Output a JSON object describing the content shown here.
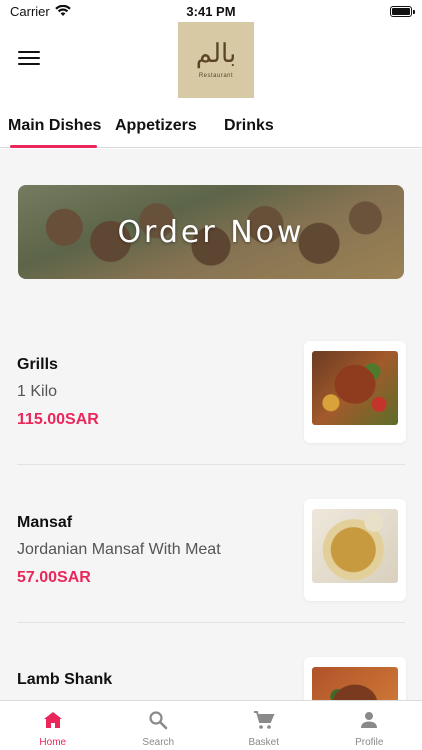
{
  "status": {
    "carrier": "Carrier",
    "time": "3:41 PM"
  },
  "header": {
    "logo_mark": "بالم",
    "logo_sub": "Restaurant"
  },
  "tabs": [
    {
      "label": "Main Dishes",
      "active": true
    },
    {
      "label": "Appetizers",
      "active": false
    },
    {
      "label": "Drinks",
      "active": false
    }
  ],
  "banner": {
    "text": "Order Now"
  },
  "items": [
    {
      "name": "Grills",
      "description": "1 Kilo",
      "price": "115.00SAR"
    },
    {
      "name": "Mansaf",
      "description": "Jordanian Mansaf With Meat",
      "price": "57.00SAR"
    },
    {
      "name": "Lamb Shank",
      "description": "",
      "price": ""
    }
  ],
  "nav": [
    {
      "label": "Home",
      "icon": "home-icon",
      "active": true
    },
    {
      "label": "Search",
      "icon": "search-icon",
      "active": false
    },
    {
      "label": "Basket",
      "icon": "cart-icon",
      "active": false
    },
    {
      "label": "Profile",
      "icon": "person-icon",
      "active": false
    }
  ],
  "colors": {
    "accent": "#e9275a",
    "background": "#f5f5f6",
    "inactive": "#8a8a8a"
  }
}
